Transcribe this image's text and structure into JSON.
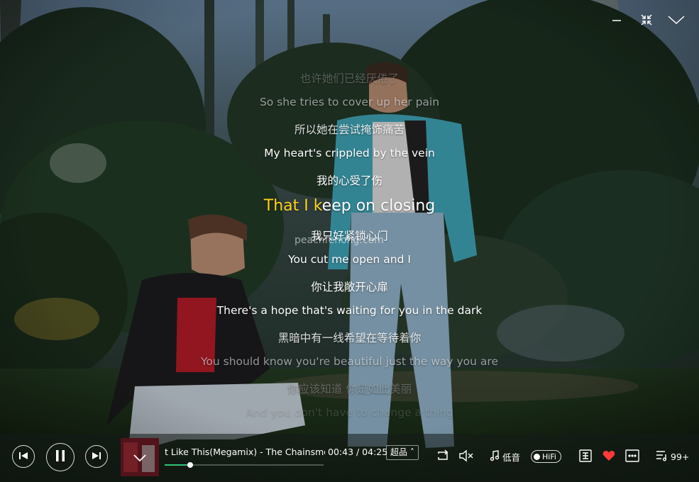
{
  "window": {
    "controls": [
      {
        "name": "minimize-icon"
      },
      {
        "name": "shrink-icon"
      },
      {
        "name": "collapse-chevron-icon"
      }
    ]
  },
  "lyrics": {
    "lines": [
      {
        "text": "也许她们已经厌倦了"
      },
      {
        "text": "So she tries to cover up her pain"
      },
      {
        "text": "所以她在尝试掩饰痛苦"
      },
      {
        "text": "My heart's crippled by the vein"
      },
      {
        "text": "我的心受了伤"
      },
      {
        "text": "我只好紧锁心门"
      },
      {
        "text": "You cut me open and I"
      },
      {
        "text": "你让我敞开心扉"
      },
      {
        "text": "There's a hope that's waiting for you in the dark"
      },
      {
        "text": "黑暗中有一线希望在等待着你"
      },
      {
        "text": "You should know you're beautiful just the way you are"
      },
      {
        "text": "你应该知道 你是如此美丽"
      },
      {
        "text": "And you don't have to change a thing"
      }
    ],
    "current": {
      "sung": "That I k",
      "unsung": "eep on closing"
    },
    "current_fraction": 0.36
  },
  "watermark": "peachfenong.com",
  "player": {
    "track_title": "t Like This(Megamix) - The Chainsmokers",
    "time_display": "00:43 / 04:25",
    "quality": "超品",
    "progress": 0.162,
    "volume_label": "低音",
    "hifi_label": "HiFi",
    "liked": true,
    "playlist_count": "99+",
    "colors": {
      "accent": "#31c27c",
      "lyric_highlight": "#ffd21e",
      "heart": "#ff3a3a"
    }
  }
}
